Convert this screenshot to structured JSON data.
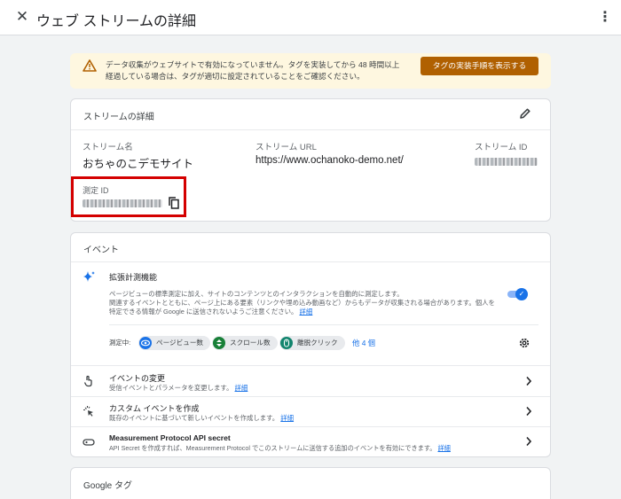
{
  "header": {
    "title": "ウェブ ストリームの詳細",
    "close_icon": "close-icon",
    "more_icon": "more-vert-icon"
  },
  "banner": {
    "text_line1": "データ収集がウェブサイトで有効になっていません。タグを実装してから 48 時間以上",
    "text_line2": "経過している場合は、タグが適切に設定されていることをご確認ください。",
    "button_label": "タグの実装手順を表示する",
    "colors": {
      "background": "#fef7e0",
      "button": "#b06000"
    }
  },
  "stream_details": {
    "title": "ストリームの詳細",
    "stream_name_label": "ストリーム名",
    "stream_name": "おちゃのこデモサイト",
    "stream_url_label": "ストリーム URL",
    "stream_url": "https://www.ochanoko-demo.net/",
    "stream_id_label": "ストリーム ID",
    "measurement_id_label": "測定 ID"
  },
  "events": {
    "title": "イベント",
    "enhanced": {
      "title": "拡張計測機能",
      "desc_line1": "ページビューの標準測定に加え、サイトのコンテンツとのインタラクションを自動的に測定します。",
      "desc_line2": "関連するイベントとともに、ページ上にある要素（リンクや埋め込み動画など）からもデータが収集される場合があります。個人を",
      "desc_line3": "特定できる情報が Google に送信されないようご注意ください。",
      "details_link": "詳細",
      "toggle_on": true,
      "measuring_label": "測定中:",
      "chips": [
        "ページビュー数",
        "スクロール数",
        "離脱クリック"
      ],
      "more_label": "他 4 個"
    },
    "rows": [
      {
        "title": "イベントの変更",
        "sub": "受信イベントとパラメータを変更します。",
        "link": "詳細"
      },
      {
        "title": "カスタム イベントを作成",
        "sub": "既存のイベントに基づいて新しいイベントを作成します。",
        "link": "詳細"
      },
      {
        "title": "Measurement Protocol API secret",
        "sub": "API Secret を作成すれば、Measurement Protocol でこのストリームに送信する追加のイベントを有効にできます。",
        "link": "詳細"
      }
    ]
  },
  "google_tag": {
    "title": "Google タグ"
  }
}
